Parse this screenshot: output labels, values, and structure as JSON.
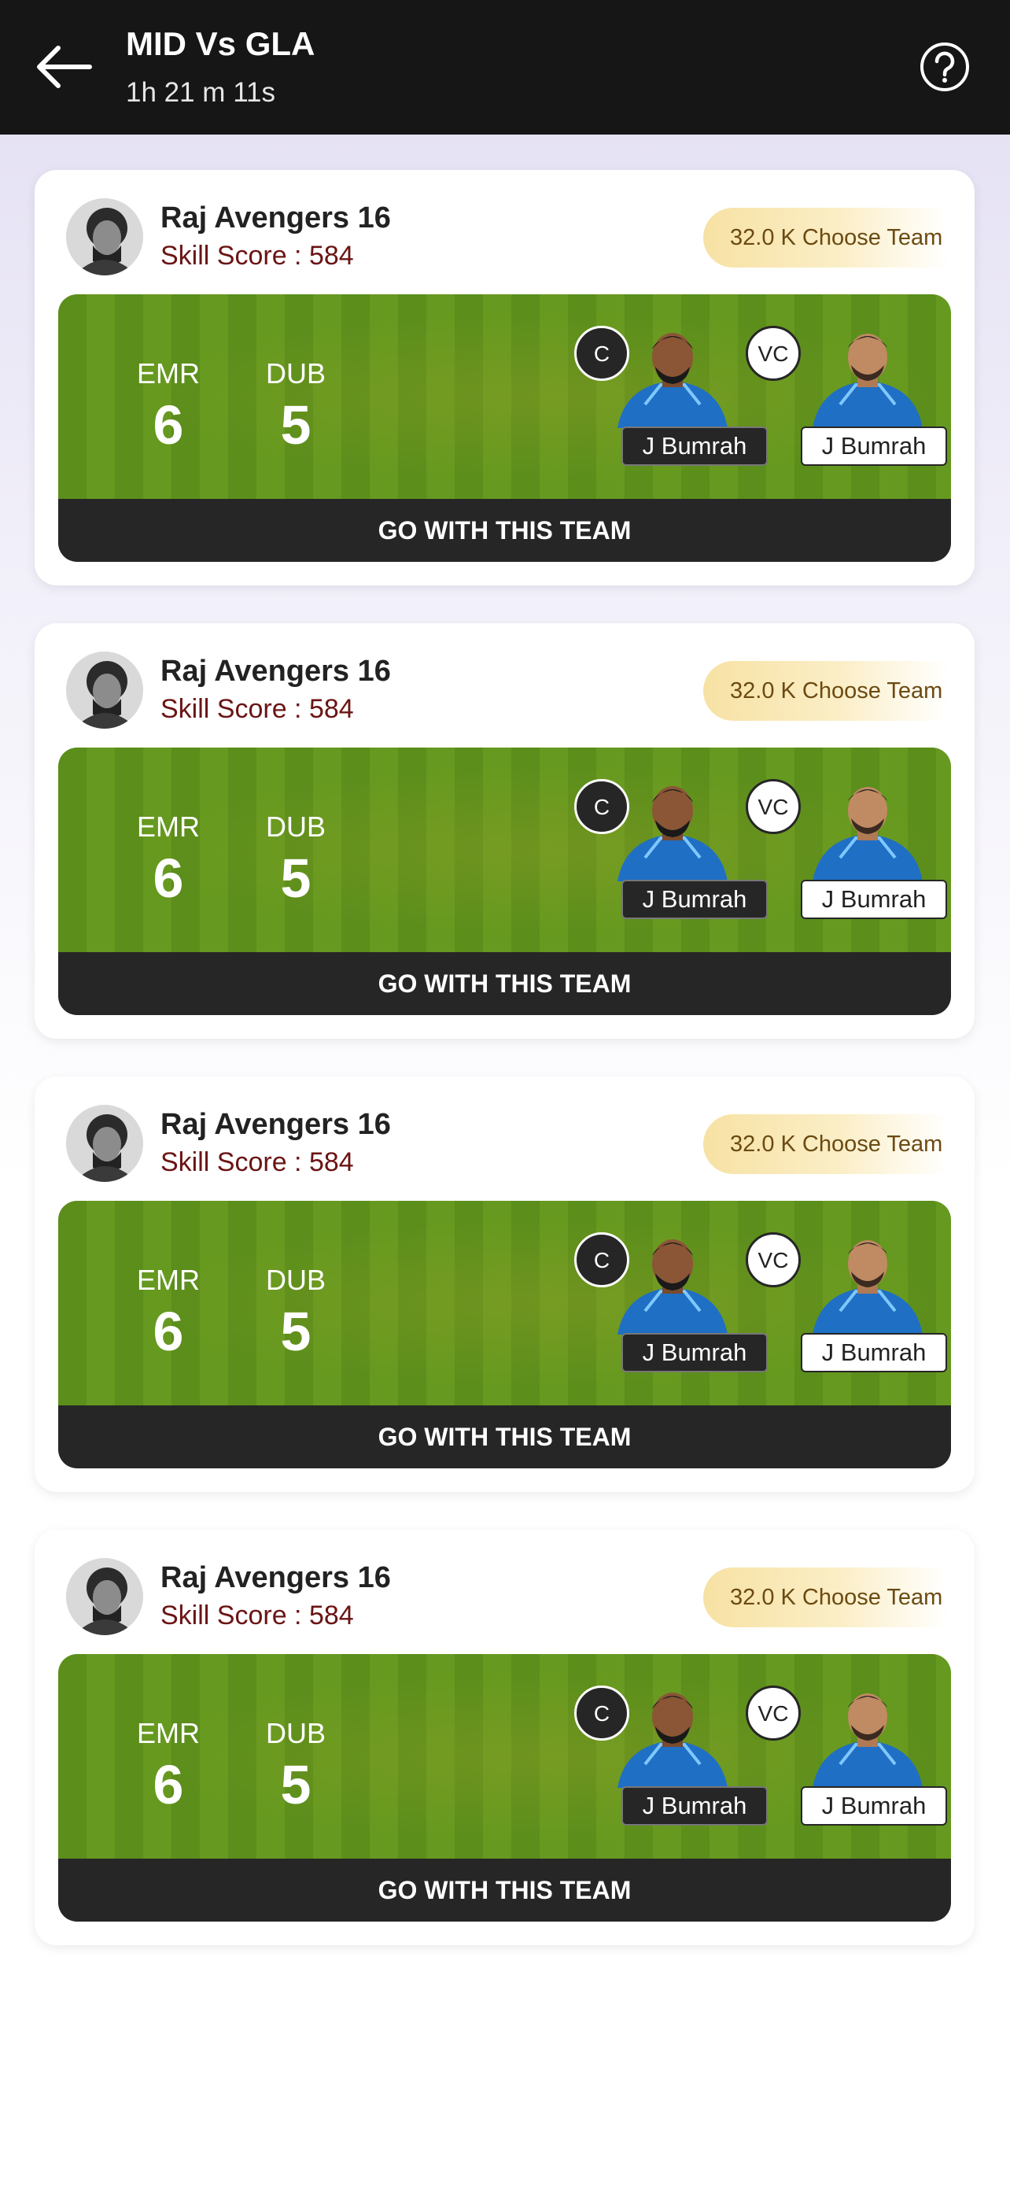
{
  "header": {
    "title": "MID Vs GLA",
    "timer": "1h 21 m 11s"
  },
  "cards": [
    {
      "team_name": "Raj Avengers 16",
      "skill_score": "Skill Score : 584",
      "choose_label": "32.0 K Choose Team",
      "teams": [
        {
          "code": "EMR",
          "count": "6"
        },
        {
          "code": "DUB",
          "count": "5"
        }
      ],
      "captain": {
        "role": "C",
        "name": "J Bumrah"
      },
      "vice_captain": {
        "role": "VC",
        "name": "J Bumrah"
      },
      "button_label": "GO WITH THIS TEAM"
    },
    {
      "team_name": "Raj Avengers 16",
      "skill_score": "Skill Score : 584",
      "choose_label": "32.0 K Choose Team",
      "teams": [
        {
          "code": "EMR",
          "count": "6"
        },
        {
          "code": "DUB",
          "count": "5"
        }
      ],
      "captain": {
        "role": "C",
        "name": "J Bumrah"
      },
      "vice_captain": {
        "role": "VC",
        "name": "J Bumrah"
      },
      "button_label": "GO WITH THIS TEAM"
    },
    {
      "team_name": "Raj Avengers 16",
      "skill_score": "Skill Score : 584",
      "choose_label": "32.0 K Choose Team",
      "teams": [
        {
          "code": "EMR",
          "count": "6"
        },
        {
          "code": "DUB",
          "count": "5"
        }
      ],
      "captain": {
        "role": "C",
        "name": "J Bumrah"
      },
      "vice_captain": {
        "role": "VC",
        "name": "J Bumrah"
      },
      "button_label": "GO WITH THIS TEAM"
    },
    {
      "team_name": "Raj Avengers 16",
      "skill_score": "Skill Score : 584",
      "choose_label": "32.0 K Choose Team",
      "teams": [
        {
          "code": "EMR",
          "count": "6"
        },
        {
          "code": "DUB",
          "count": "5"
        }
      ],
      "captain": {
        "role": "C",
        "name": "J Bumrah"
      },
      "vice_captain": {
        "role": "VC",
        "name": "J Bumrah"
      },
      "button_label": "GO WITH THIS TEAM"
    }
  ],
  "icons": {
    "back": "back-arrow-icon",
    "help": "help-icon",
    "avatar": "user-avatar"
  },
  "colors": {
    "header_bg": "#161616",
    "pitch_green": "#5b8e1b",
    "skill_score": "#6b1414",
    "badge_gold": "#f7e2a4",
    "button_bg": "#262626"
  }
}
